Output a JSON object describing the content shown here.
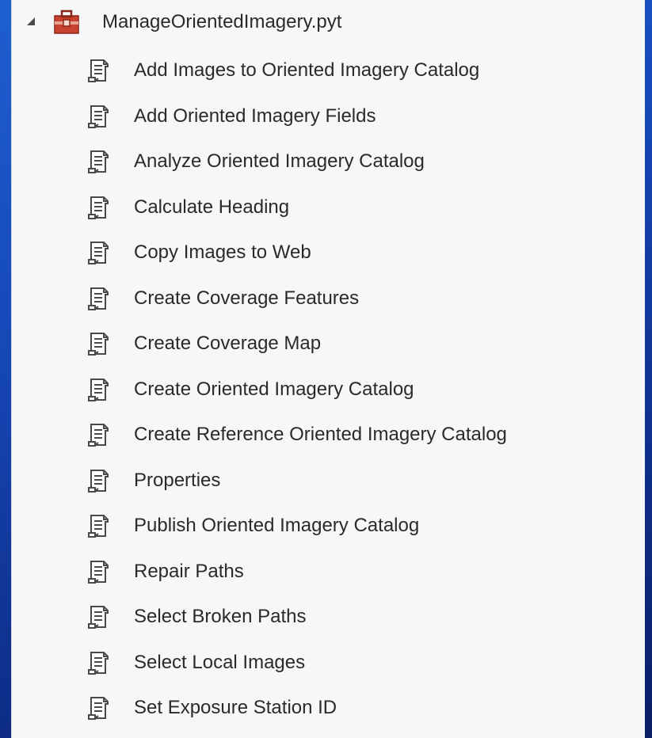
{
  "catalog": {
    "root": {
      "label": "ManageOrientedImagery.pyt",
      "icon": "toolbox-icon",
      "expander_icon": "expanded-triangle-icon"
    },
    "item_icon": "script-tool-icon",
    "items": [
      {
        "label": "Add Images to Oriented Imagery Catalog"
      },
      {
        "label": "Add Oriented Imagery Fields"
      },
      {
        "label": "Analyze Oriented Imagery Catalog"
      },
      {
        "label": "Calculate Heading"
      },
      {
        "label": "Copy Images to Web"
      },
      {
        "label": "Create Coverage Features"
      },
      {
        "label": "Create Coverage Map"
      },
      {
        "label": "Create Oriented Imagery Catalog"
      },
      {
        "label": "Create Reference Oriented Imagery Catalog"
      },
      {
        "label": "Properties"
      },
      {
        "label": "Publish Oriented Imagery Catalog"
      },
      {
        "label": "Repair Paths"
      },
      {
        "label": "Select Broken Paths"
      },
      {
        "label": "Select Local Images"
      },
      {
        "label": "Set Exposure Station ID"
      }
    ]
  },
  "colors": {
    "background_gradient_start": "#1f5fd0",
    "background_gradient_end": "#0a1f66",
    "panel": "#f6f7f8",
    "text": "#2a2a2a",
    "toolbox_red": "#c0392b",
    "icon_gray": "#4a4a4a"
  }
}
